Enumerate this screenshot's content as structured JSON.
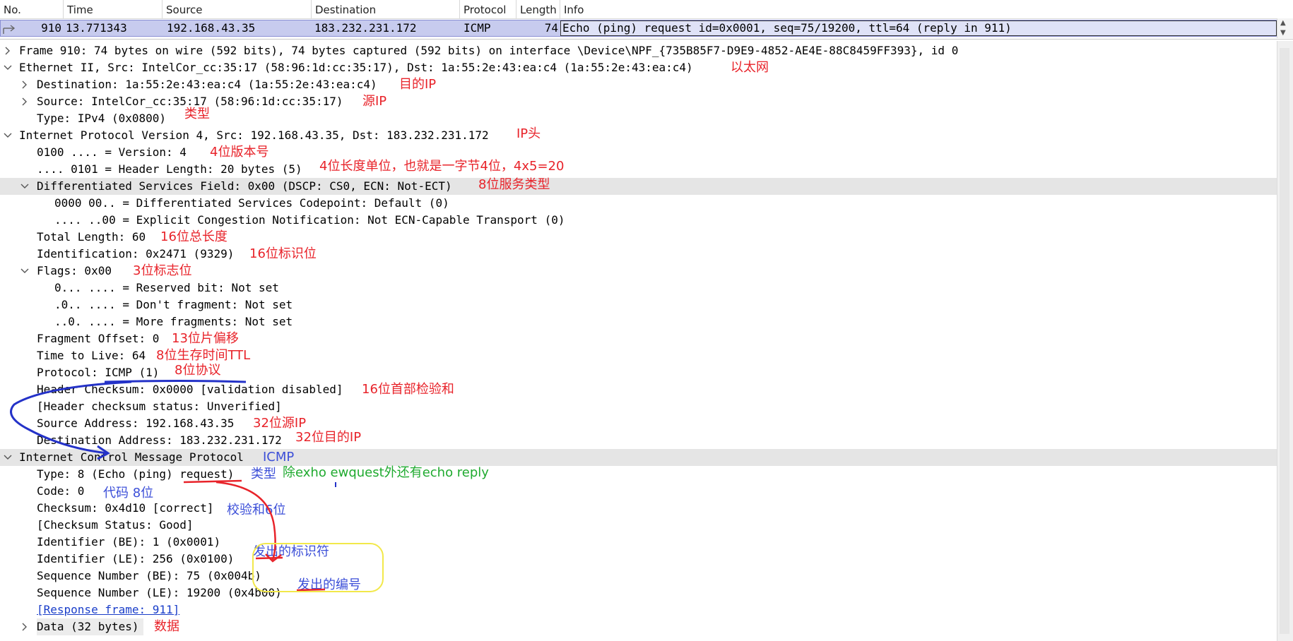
{
  "packet_list": {
    "columns": [
      "No.",
      "Time",
      "Source",
      "Destination",
      "Protocol",
      "Length",
      "Info"
    ],
    "selected_row": {
      "no": "910",
      "time": "13.771343",
      "source": "192.168.43.35",
      "destination": "183.232.231.172",
      "protocol": "ICMP",
      "length": "74",
      "info": "Echo (ping) request  id=0x0001, seq=75/19200, ttl=64 (reply in 911)"
    }
  },
  "details": {
    "frame": "Frame 910: 74 bytes on wire (592 bits), 74 bytes captured (592 bits) on interface \\Device\\NPF_{735B85F7-D9E9-4852-AE4E-88C8459FF393}, id 0",
    "ethernet": "Ethernet II, Src: IntelCor_cc:35:17 (58:96:1d:cc:35:17), Dst: 1a:55:2e:43:ea:c4 (1a:55:2e:43:ea:c4)",
    "eth_dst": "Destination: 1a:55:2e:43:ea:c4 (1a:55:2e:43:ea:c4)",
    "eth_src": "Source: IntelCor_cc:35:17 (58:96:1d:cc:35:17)",
    "eth_type": "Type: IPv4 (0x0800)",
    "ipv4": "Internet Protocol Version 4, Src: 192.168.43.35, Dst: 183.232.231.172",
    "ip_version": "0100 .... = Version: 4",
    "ip_hlen": ".... 0101 = Header Length: 20 bytes (5)",
    "ip_dsfield": "Differentiated Services Field: 0x00 (DSCP: CS0, ECN: Not-ECT)",
    "ip_dscp": "0000 00.. = Differentiated Services Codepoint: Default (0)",
    "ip_ecn": ".... ..00 = Explicit Congestion Notification: Not ECN-Capable Transport (0)",
    "ip_total_len": "Total Length: 60",
    "ip_id": "Identification: 0x2471 (9329)",
    "ip_flags": "Flags: 0x00",
    "ip_flag_rb": "0... .... = Reserved bit: Not set",
    "ip_flag_df": ".0.. .... = Don't fragment: Not set",
    "ip_flag_mf": "..0. .... = More fragments: Not set",
    "ip_frag": "Fragment Offset: 0",
    "ip_ttl": "Time to Live: 64",
    "ip_proto": "Protocol: ICMP (1)",
    "ip_checksum": "Header Checksum: 0x0000 [validation disabled]",
    "ip_checksum_status": "[Header checksum status: Unverified]",
    "ip_src": "Source Address: 192.168.43.35",
    "ip_dst": "Destination Address: 183.232.231.172",
    "icmp": "Internet Control Message Protocol",
    "icmp_type": "Type: 8 (Echo (ping) request)",
    "icmp_code": "Code: 0",
    "icmp_checksum": "Checksum: 0x4d10 [correct]",
    "icmp_checksum_status": "[Checksum Status: Good]",
    "icmp_id_be": "Identifier (BE): 1 (0x0001)",
    "icmp_id_le": "Identifier (LE): 256 (0x0100)",
    "icmp_seq_be": "Sequence Number (BE): 75 (0x004b)",
    "icmp_seq_le": "Sequence Number (LE): 19200 (0x4b00)",
    "icmp_response": "[Response frame: 911]",
    "data": "Data (32 bytes)"
  },
  "annotations": {
    "ethernet": "以太网",
    "eth_dst": "目的IP",
    "eth_src": "源IP",
    "eth_type": "类型",
    "ipv4": "IP头",
    "ip_version": "4位版本号",
    "ip_hlen": "4位长度单位，也就是一字节4位，4x5=20",
    "ip_dsfield": "8位服务类型",
    "ip_total_len": "16位总长度",
    "ip_id": "16位标识位",
    "ip_flags": "3位标志位",
    "ip_frag": "13位片偏移",
    "ip_ttl": "8位生存时间TTL",
    "ip_proto": "8位协议",
    "ip_checksum": "16位首部检验和",
    "ip_src": "32位源IP",
    "ip_dst": "32位目的IP",
    "icmp": "ICMP",
    "icmp_type": "类型",
    "icmp_type_note": "除exho ewquest外还有echo reply",
    "icmp_code": "代码 8位",
    "icmp_checksum": "校验和6位",
    "icmp_id": "发出的标识符",
    "icmp_seq": "发出的编号",
    "data": "数据"
  },
  "colors": {
    "selected_row": "#c7cbee",
    "highlight_row": "#e5e5e5",
    "annotation_red": "#e8232a",
    "annotation_blue": "#3c4fd8",
    "annotation_green": "#1faa2f",
    "highlight_box": "#f2e84a"
  },
  "icons": [
    "expand-arrow",
    "collapse-arrow",
    "row-marker-arrow",
    "scroll-up",
    "scroll-down"
  ]
}
